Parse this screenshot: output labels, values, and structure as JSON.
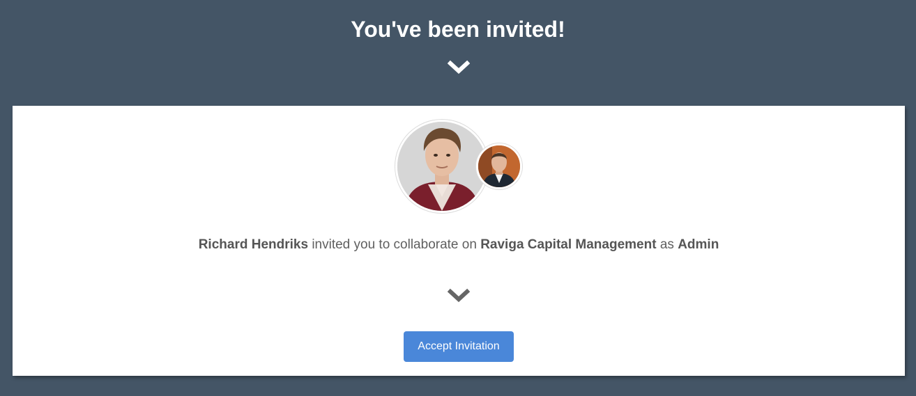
{
  "header": {
    "title": "You've been invited!",
    "chevron_icon": "chevron-down-icon"
  },
  "invitation": {
    "inviter_name": "Richard Hendriks",
    "text_invited": "invited you to collaborate on",
    "organization": "Raviga Capital Management",
    "text_as": "as",
    "role": "Admin",
    "chevron_icon": "chevron-down-icon",
    "accept_label": "Accept Invitation"
  },
  "colors": {
    "background": "#445566",
    "card": "#ffffff",
    "accent": "#4a87d9",
    "text": "#5f5f5f"
  }
}
